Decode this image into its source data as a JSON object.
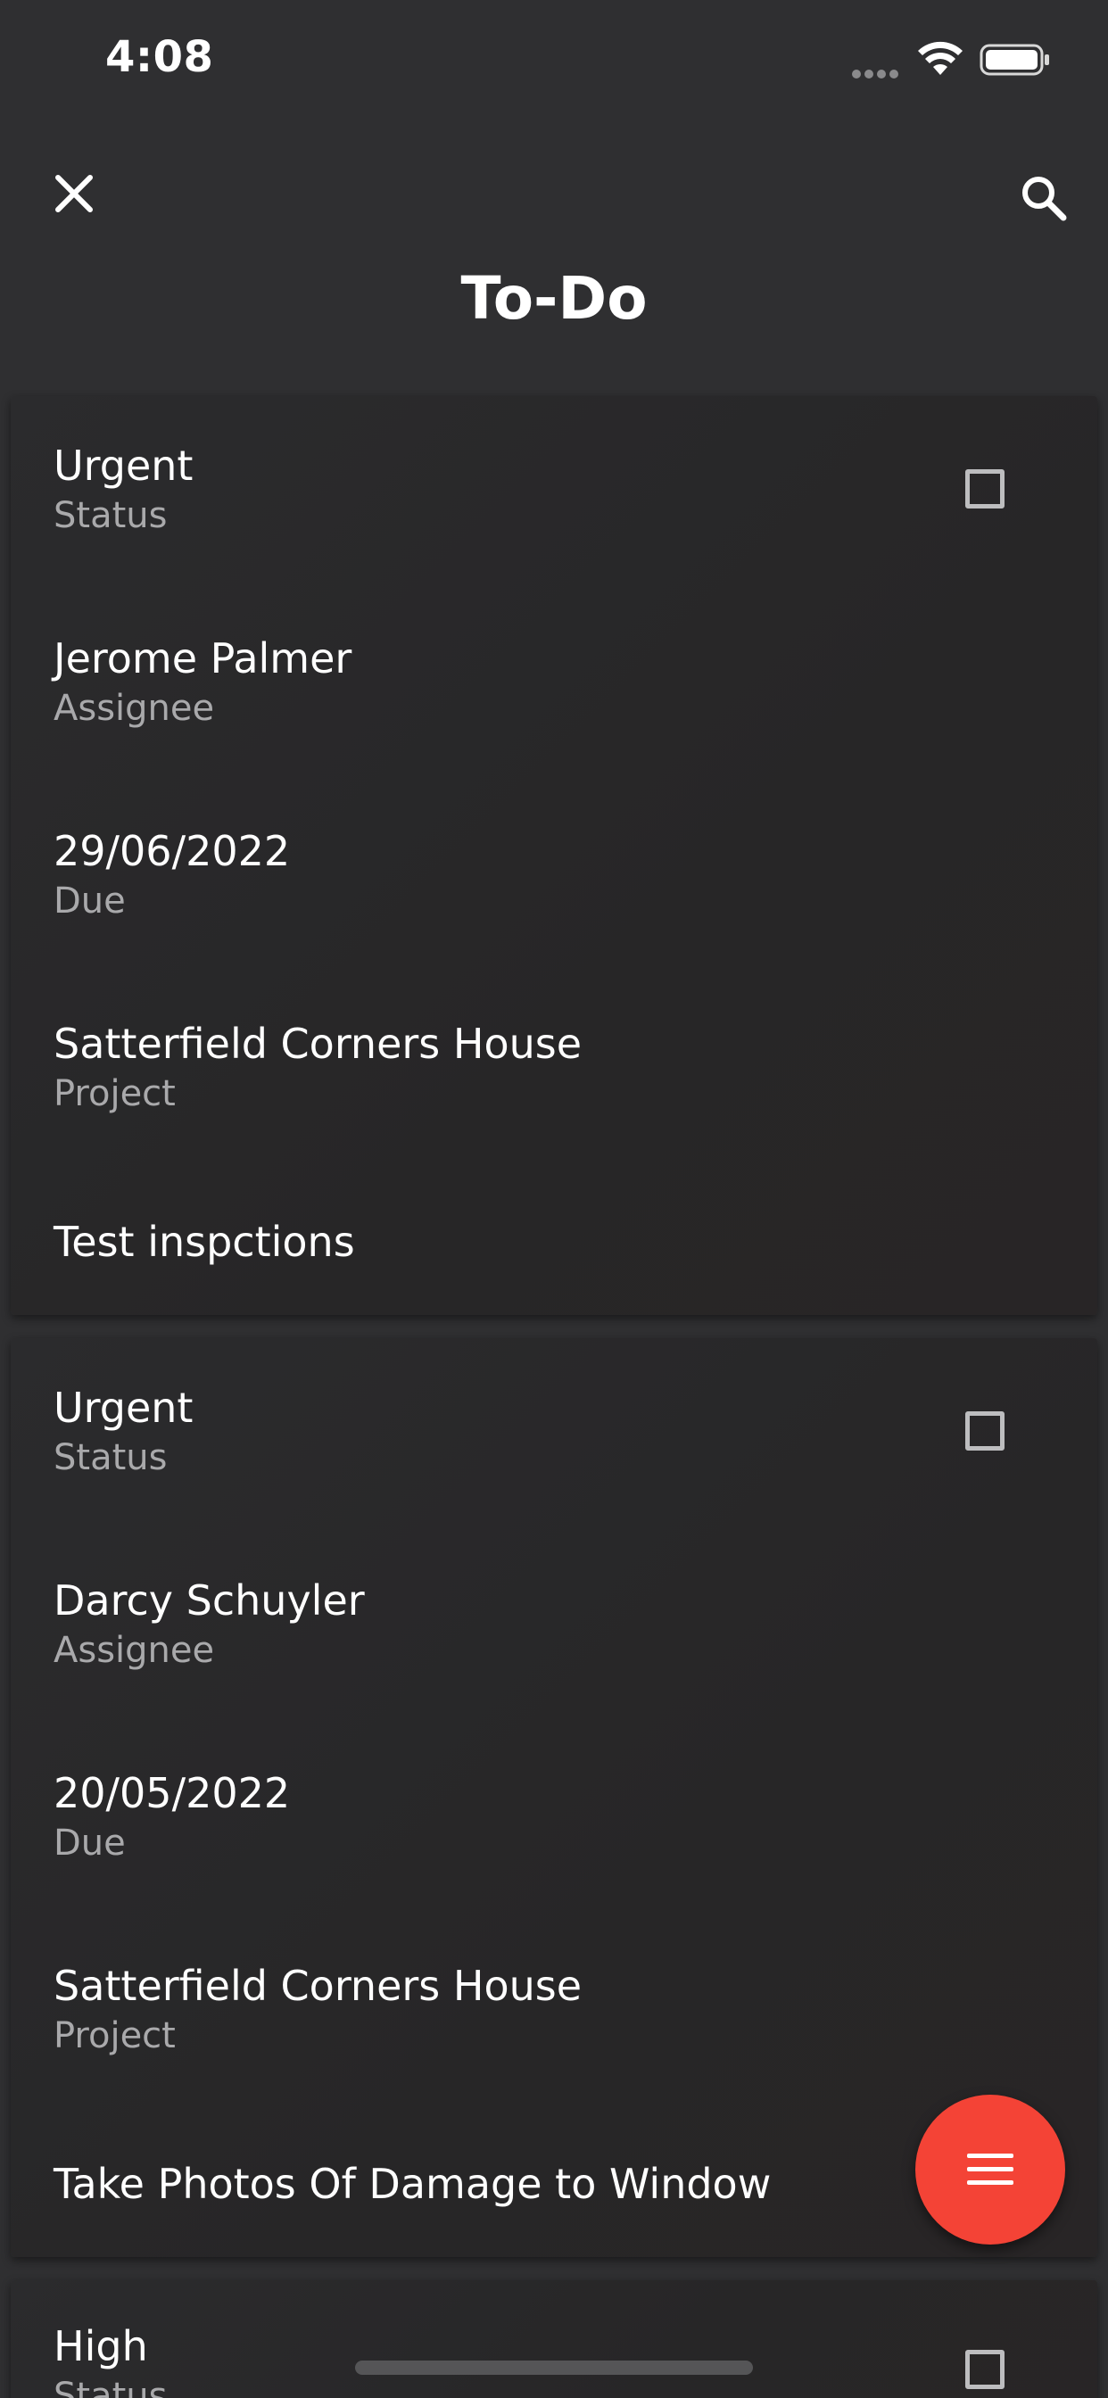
{
  "status_bar": {
    "time": "4:08"
  },
  "header": {
    "title": "To-Do",
    "close_icon": "close-icon",
    "search_icon": "search-icon"
  },
  "todos": [
    {
      "status": "Urgent",
      "status_label": "Status",
      "assignee": "Jerome Palmer",
      "assignee_label": "Assignee",
      "due": "29/06/2022",
      "due_label": "Due",
      "project": "Satterfield Corners House",
      "project_label": "Project",
      "description": "Test inspctions",
      "checked": false
    },
    {
      "status": "Urgent",
      "status_label": "Status",
      "assignee": "Darcy Schuyler",
      "assignee_label": "Assignee",
      "due": "20/05/2022",
      "due_label": "Due",
      "project": "Satterfield Corners House",
      "project_label": "Project",
      "description": "Take Photos Of Damage to Window",
      "checked": false
    },
    {
      "status": "High",
      "status_label": "Status",
      "checked": false
    }
  ],
  "fab": {
    "icon": "menu-icon",
    "color": "#f44336"
  },
  "colors": {
    "background": "#2f2f31",
    "card": "#2a292b",
    "accent": "#f44336"
  }
}
